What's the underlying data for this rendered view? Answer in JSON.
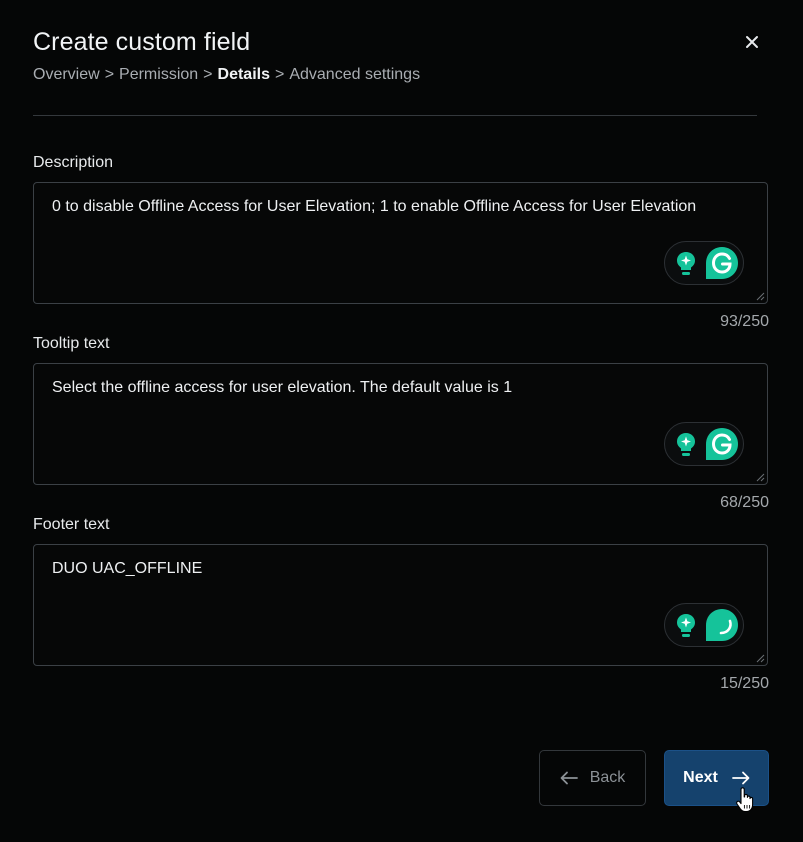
{
  "dialog": {
    "title": "Create custom field",
    "close_icon": "close-icon",
    "breadcrumb": [
      {
        "label": "Overview",
        "current": false
      },
      {
        "label": "Permission",
        "current": false
      },
      {
        "label": "Details",
        "current": true
      },
      {
        "label": "Advanced settings",
        "current": false
      }
    ],
    "breadcrumb_separator": ">"
  },
  "fields": [
    {
      "label": "Description",
      "value": "0 to disable Offline Access for User Elevation; 1 to enable Offline Access for User Elevation",
      "counter": "93/250"
    },
    {
      "label": "Tooltip text",
      "value": "Select the offline access for user elevation. The default value is 1",
      "counter": "68/250"
    },
    {
      "label": "Footer text",
      "value": "DUO UAC_OFFLINE",
      "counter": "15/250"
    }
  ],
  "footer": {
    "back_label": "Back",
    "next_label": "Next"
  },
  "icons": {
    "grammarly_assist": "lightbulb-sparkle-icon",
    "grammarly": "grammarly-g-icon",
    "back": "arrow-left-icon",
    "next": "arrow-right-icon",
    "cursor": "hand-pointer-icon"
  },
  "colors": {
    "background": "#050606",
    "accent_button": "#15426d",
    "grammarly_green": "#15c39a"
  }
}
